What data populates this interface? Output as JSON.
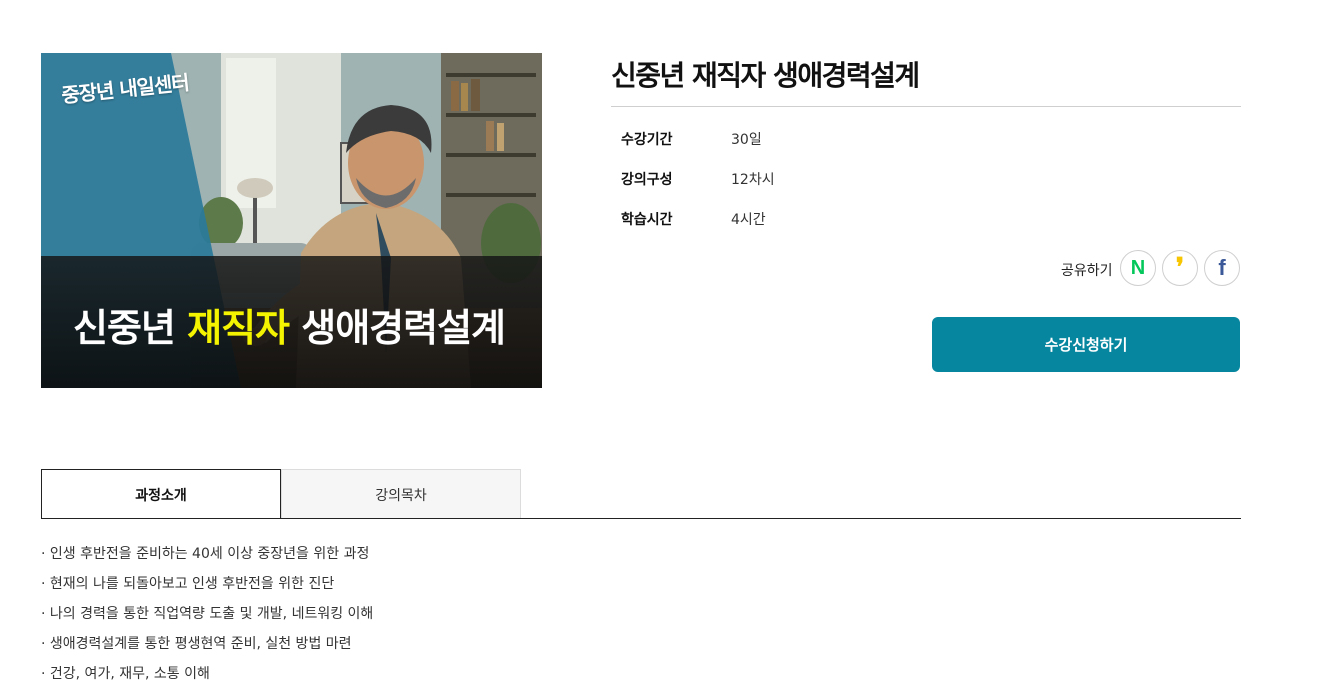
{
  "thumbnail": {
    "logo_text": "중장년 내일센터",
    "banner_prefix": "신중년 ",
    "banner_highlight": "재직자",
    "banner_suffix": " 생애경력설계"
  },
  "course": {
    "title": "신중년 재직자 생애경력설계",
    "info": [
      {
        "label": "수강기간",
        "value": "30일"
      },
      {
        "label": "강의구성",
        "value": "12차시"
      },
      {
        "label": "학습시간",
        "value": "4시간"
      }
    ]
  },
  "share": {
    "label": "공유하기",
    "naver_glyph": "N",
    "kakao_glyph": "❜",
    "facebook_glyph": "f"
  },
  "apply_label": "수강신청하기",
  "tabs": [
    {
      "label": "과정소개",
      "active": true
    },
    {
      "label": "강의목차",
      "active": false
    }
  ],
  "intro_items": [
    "· 인생 후반전을 준비하는 40세 이상 중장년을 위한 과정",
    "· 현재의 나를 되돌아보고 인생 후반전을 위한 진단",
    "· 나의 경력을 통한 직업역량 도출 및 개발, 네트워킹 이해",
    "· 생애경력설계를 통한 평생현역 준비, 실천 방법 마련",
    "· 건강, 여가, 재무, 소통 이해"
  ],
  "colors": {
    "accent": "#06869f",
    "highlight": "#f4f300",
    "naver": "#03c75a",
    "kakao": "#f7c600",
    "facebook": "#3b5998"
  }
}
